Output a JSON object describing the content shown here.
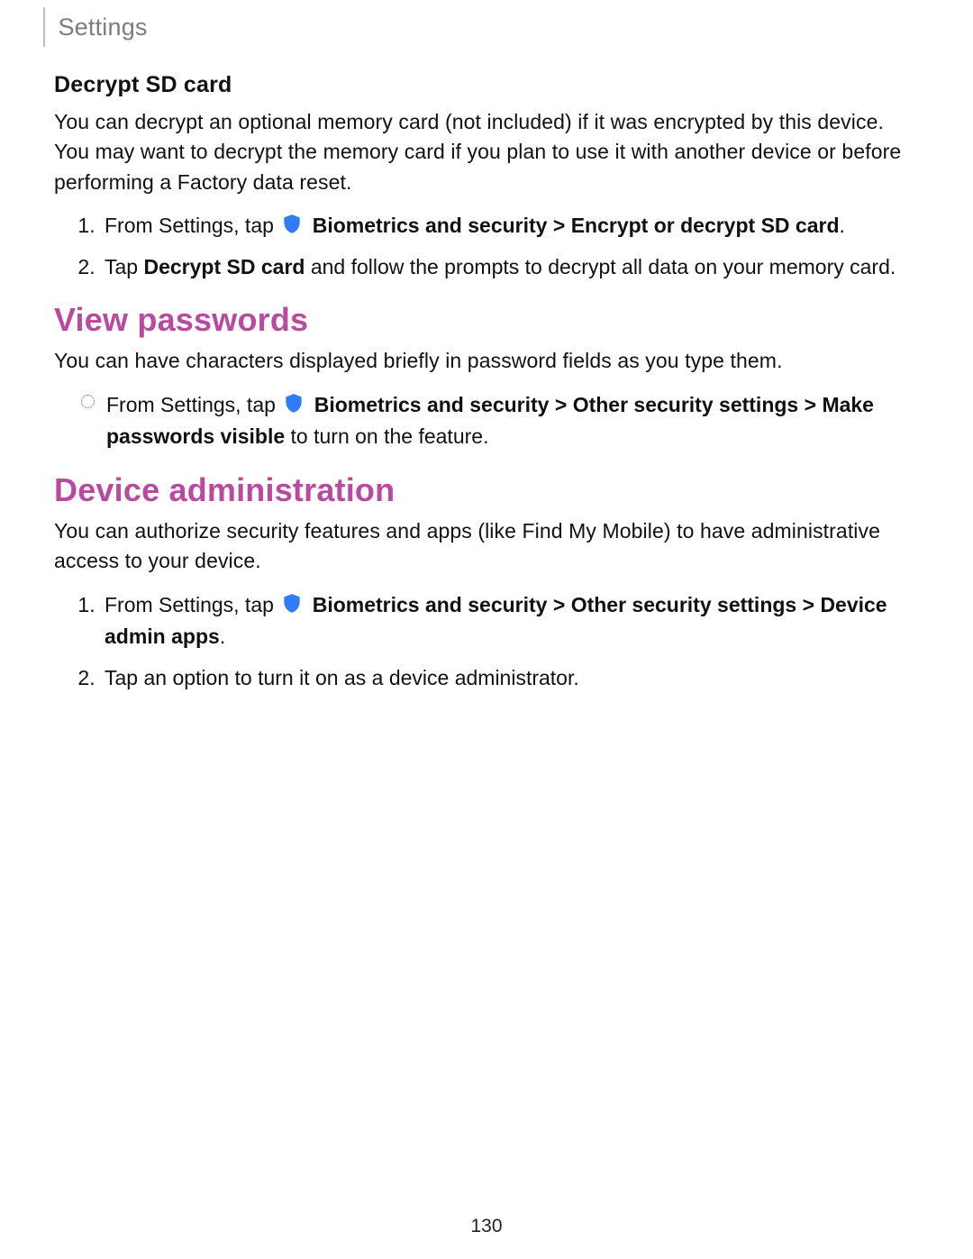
{
  "header": {
    "title": "Settings"
  },
  "page_number": "130",
  "sectionA": {
    "heading": "Decrypt SD card",
    "intro": "You can decrypt an optional memory card (not included) if it was encrypted by this device. You may want to decrypt the memory card if you plan to use it with another device or before performing a Factory data reset.",
    "step1_pre": "From Settings, tap ",
    "step1_b1": "Biometrics and security",
    "chev": ">",
    "step1_b2": "Encrypt or decrypt SD card",
    "step1_end": ".",
    "step2_pre": "Tap ",
    "step2_b1": "Decrypt SD card",
    "step2_post": " and follow the prompts to decrypt all data on your memory card."
  },
  "sectionB": {
    "title": "View passwords",
    "intro": "You can have characters displayed briefly in password fields as you type them.",
    "bullet_pre": "From Settings, tap ",
    "bullet_b1": "Biometrics and security",
    "bullet_b2": "Other security settings",
    "bullet_b3": "Make passwords visible",
    "bullet_post": " to turn on the feature."
  },
  "sectionC": {
    "title": "Device administration",
    "intro": "You can authorize security features and apps (like Find My Mobile) to have administrative access to your device.",
    "step1_pre": "From Settings, tap ",
    "step1_b1": "Biometrics and security",
    "step1_b2": "Other security settings",
    "step1_b3": "Device admin apps",
    "step1_end": ".",
    "step2": "Tap an option to turn it on as a device administrator."
  }
}
